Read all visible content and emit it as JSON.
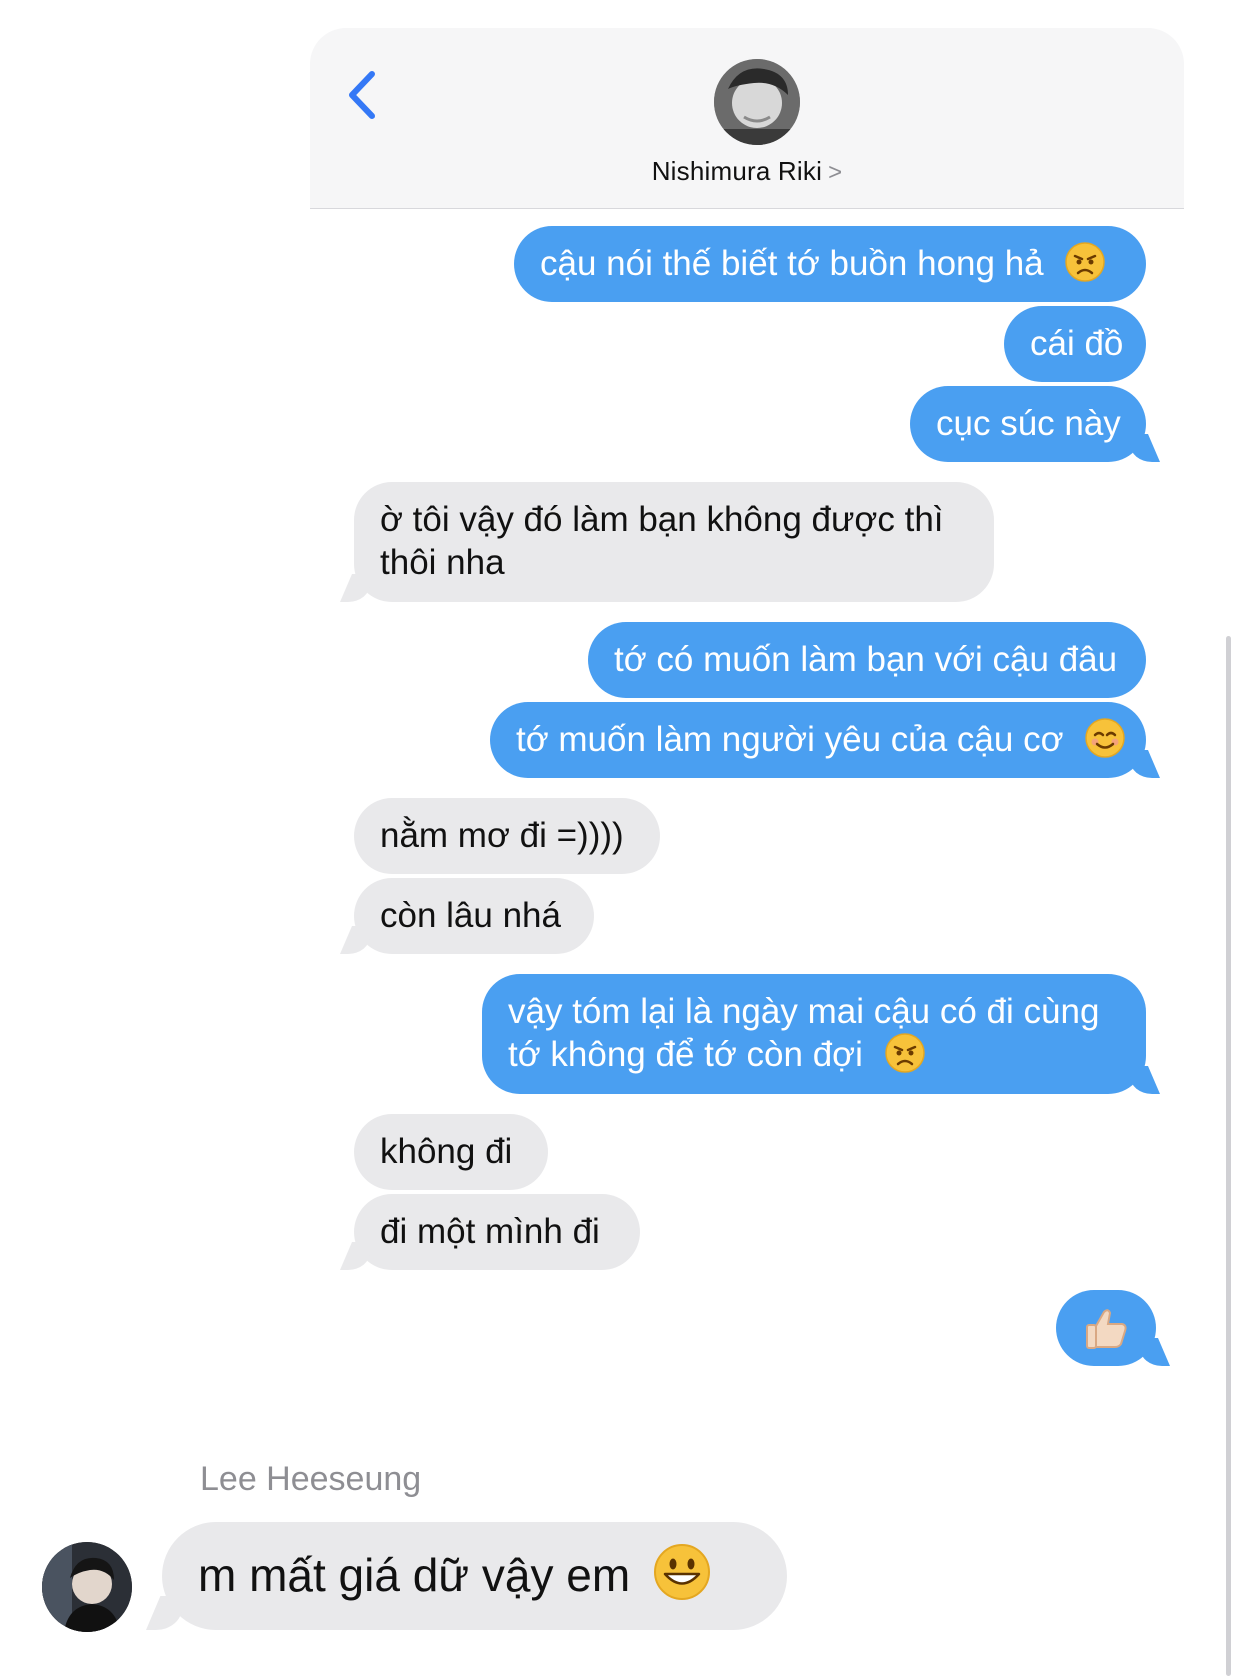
{
  "header": {
    "contact_name": "Nishimura Riki",
    "chevron": ">",
    "back_icon": "chevron-left-icon",
    "accent_color": "#3478f6"
  },
  "messages": [
    {
      "side": "sent",
      "text": "cậu nói thế biết tớ buồn hong hả",
      "emoji": "angry-face"
    },
    {
      "side": "sent",
      "text": "cái đồ"
    },
    {
      "side": "sent",
      "text": "cục súc này"
    },
    {
      "side": "recv",
      "line1": "ờ tôi vậy đó làm bạn không được thì",
      "line2": "thôi nha"
    },
    {
      "side": "sent",
      "text": "tớ có muốn làm bạn với cậu đâu"
    },
    {
      "side": "sent",
      "text": "tớ muốn làm người yêu của cậu cơ",
      "emoji": "smiling-face"
    },
    {
      "side": "recv",
      "text": "nằm mơ đi =))))"
    },
    {
      "side": "recv",
      "text": "còn lâu nhá"
    },
    {
      "side": "sent",
      "line1": "vậy tóm lại là ngày mai cậu có đi cùng",
      "line2": "tớ không để tớ còn đợi",
      "emoji": "angry-face"
    },
    {
      "side": "recv",
      "text": "không đi"
    },
    {
      "side": "recv",
      "text": "đi một mình đi"
    },
    {
      "side": "sent",
      "emoji": "thumbs-up"
    }
  ],
  "reply": {
    "sender": "Lee Heeseung",
    "text": "m mất giá dữ vậy em",
    "emoji": "grinning-face"
  },
  "colors": {
    "sent_bubble": "#4a9ff1",
    "received_bubble": "#e9e9eb"
  }
}
